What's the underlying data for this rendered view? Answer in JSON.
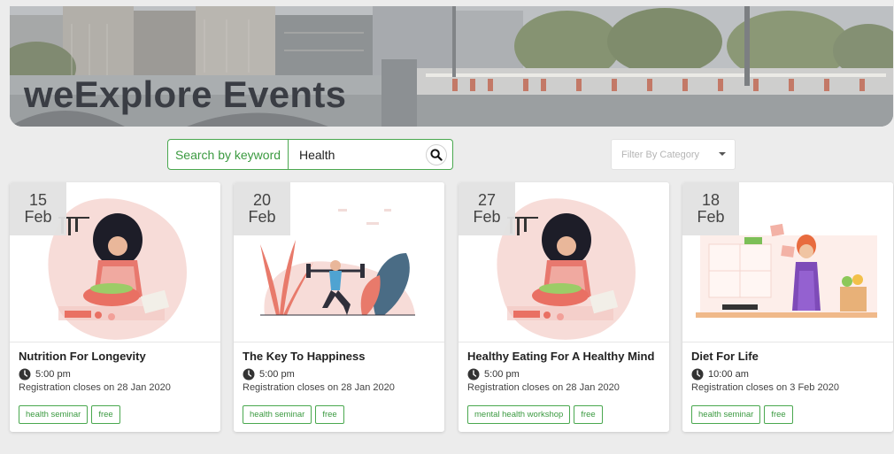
{
  "hero": {
    "title": "weExplore Events"
  },
  "search": {
    "label": "Search by keyword",
    "value": "Health"
  },
  "filter": {
    "placeholder": "Filter By Category"
  },
  "colors": {
    "accent": "#4aa84f",
    "title": "#3a3d44",
    "background": "#ececec"
  },
  "events": [
    {
      "day": "15",
      "month": "Feb",
      "title": "Nutrition For Longevity",
      "time": "5:00 pm",
      "registration": "Registration closes on 28 Jan 2020",
      "tags": [
        "health seminar",
        "free"
      ]
    },
    {
      "day": "20",
      "month": "Feb",
      "title": "The Key To Happiness",
      "time": "5:00 pm",
      "registration": "Registration closes on 28 Jan 2020",
      "tags": [
        "health seminar",
        "free"
      ]
    },
    {
      "day": "27",
      "month": "Feb",
      "title": "Healthy Eating For A Healthy Mind",
      "time": "5:00 pm",
      "registration": "Registration closes on 28 Jan 2020",
      "tags": [
        "mental health workshop",
        "free"
      ]
    },
    {
      "day": "18",
      "month": "Feb",
      "title": "Diet For Life",
      "time": "10:00 am",
      "registration": "Registration closes on 3 Feb 2020",
      "tags": [
        "health seminar",
        "free"
      ]
    }
  ]
}
